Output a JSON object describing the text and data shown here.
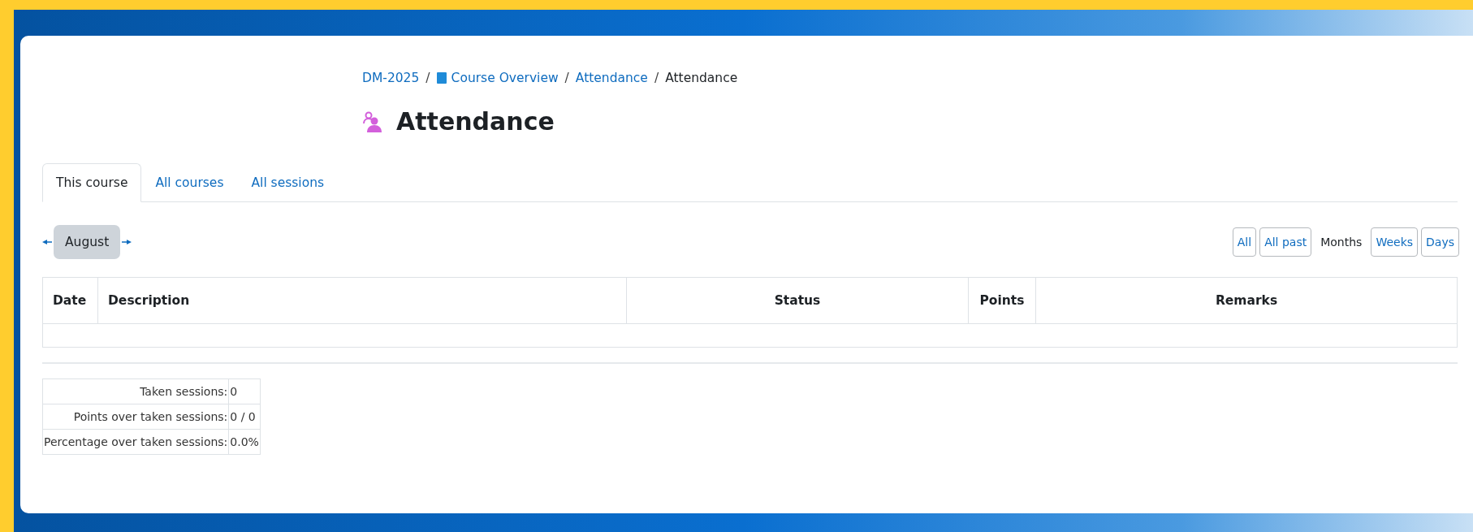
{
  "breadcrumb": [
    {
      "kind": "link",
      "label": "DM-2025"
    },
    {
      "kind": "separator",
      "label": "/"
    },
    {
      "kind": "course_link",
      "label": "Course Overview"
    },
    {
      "kind": "separator",
      "label": "/"
    },
    {
      "kind": "link",
      "label": "Attendance"
    },
    {
      "kind": "separator",
      "label": "/"
    },
    {
      "kind": "current",
      "label": "Attendance"
    }
  ],
  "title": "Attendance",
  "tabs": [
    {
      "label": "This course",
      "selected": true
    },
    {
      "label": "All courses",
      "selected": false
    },
    {
      "label": "All sessions",
      "selected": false
    }
  ],
  "period": {
    "label": "August"
  },
  "view_buttons": [
    {
      "label": "All",
      "selected": false
    },
    {
      "label": "All past",
      "selected": false
    },
    {
      "label": "Months",
      "selected": true
    },
    {
      "label": "Weeks",
      "selected": false
    },
    {
      "label": "Days",
      "selected": false
    }
  ],
  "table": {
    "columns": [
      "Date",
      "Description",
      "Status",
      "Points",
      "Remarks"
    ]
  },
  "summary": [
    {
      "label": "Taken sessions:",
      "value": "0"
    },
    {
      "label": "Points over taken sessions:",
      "value": "0 / 0"
    },
    {
      "label": "Percentage over taken sessions:",
      "value": "0.0%"
    }
  ]
}
